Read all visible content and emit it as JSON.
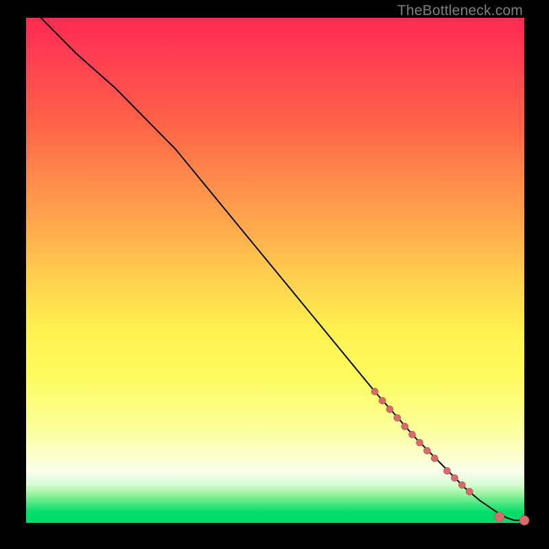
{
  "watermark": "TheBottleneck.com",
  "colors": {
    "dot_fill": "#d86b6a",
    "dot_stroke": "#a84e50",
    "curve": "#000000"
  },
  "chart_data": {
    "type": "line",
    "title": "",
    "xlabel": "",
    "ylabel": "",
    "xlim": [
      0,
      100
    ],
    "ylim": [
      0,
      100
    ],
    "series": [
      {
        "name": "curve",
        "x": [
          0,
          4,
          10,
          18,
          25,
          30,
          40,
          50,
          60,
          70,
          78,
          84,
          88,
          91,
          93.5,
          95,
          96.5,
          98,
          100
        ],
        "y": [
          103,
          99,
          93,
          86,
          79,
          74,
          62,
          50,
          38,
          26,
          17,
          11,
          7,
          4.5,
          2.8,
          1.8,
          1.0,
          0.5,
          0.5
        ]
      }
    ],
    "points": [
      {
        "x": 70.0,
        "y": 26.0
      },
      {
        "x": 71.5,
        "y": 24.2
      },
      {
        "x": 73.0,
        "y": 22.5
      },
      {
        "x": 74.5,
        "y": 20.8
      },
      {
        "x": 76.0,
        "y": 19.1
      },
      {
        "x": 77.5,
        "y": 17.5
      },
      {
        "x": 79.0,
        "y": 15.9
      },
      {
        "x": 80.5,
        "y": 14.3
      },
      {
        "x": 82.0,
        "y": 12.8
      },
      {
        "x": 84.5,
        "y": 10.3
      },
      {
        "x": 86.0,
        "y": 8.9
      },
      {
        "x": 87.5,
        "y": 7.5
      },
      {
        "x": 89.0,
        "y": 6.2
      },
      {
        "x": 95.0,
        "y": 1.2
      },
      {
        "x": 100.0,
        "y": 0.5
      }
    ],
    "point_radius_default": 5,
    "point_radius_large": 7
  }
}
